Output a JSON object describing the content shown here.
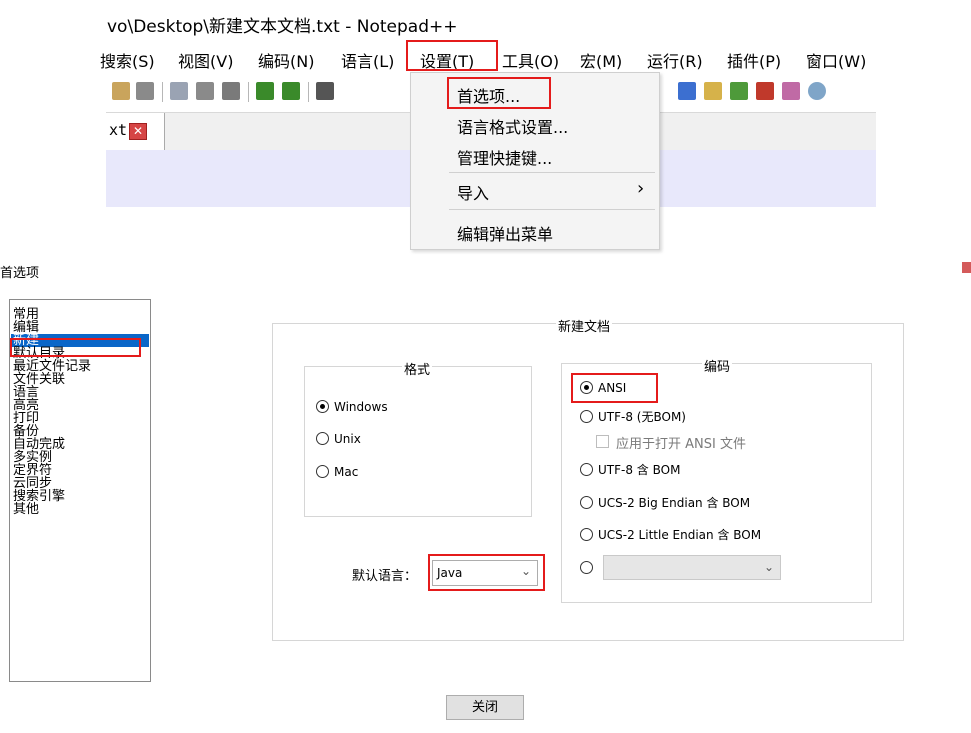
{
  "notepad": {
    "title": "vo\\Desktop\\新建文本文档.txt - Notepad++",
    "menubar": [
      "搜索(S)",
      "视图(V)",
      "编码(N)",
      "语言(L)",
      "设置(T)",
      "工具(O)",
      "宏(M)",
      "运行(R)",
      "插件(P)",
      "窗口(W)"
    ],
    "tab": {
      "label": "xt",
      "close_glyph": "✕"
    },
    "settings_menu": [
      "首选项...",
      "语言格式设置...",
      "管理快捷键...",
      "导入",
      "编辑弹出菜单"
    ],
    "submenu_arrow": "›"
  },
  "dialog": {
    "title": "首选项",
    "categories": [
      "常用",
      "编辑",
      "新建",
      "默认目录",
      "最近文件记录",
      "文件关联",
      "语言",
      "高亮",
      "打印",
      "备份",
      "自动完成",
      "多实例",
      "定界符",
      "云同步",
      "搜索引擎",
      "其他"
    ],
    "selected_category": "新建",
    "new_doc_group": "新建文档",
    "format": {
      "legend": "格式",
      "options": [
        "Windows",
        "Unix",
        "Mac"
      ],
      "selected": "Windows"
    },
    "encoding": {
      "legend": "编码",
      "options": [
        "ANSI",
        "UTF-8 (无BOM)",
        "UTF-8 含 BOM",
        "UCS-2 Big Endian 含 BOM",
        "UCS-2 Little Endian 含 BOM"
      ],
      "selected": "ANSI",
      "apply_checkbox": "应用于打开 ANSI 文件"
    },
    "default_language": {
      "label": "默认语言：",
      "value": "Java"
    },
    "close_button": "关闭",
    "highlight_color": "#e41b1b",
    "selection_color": "#0a66c8"
  }
}
